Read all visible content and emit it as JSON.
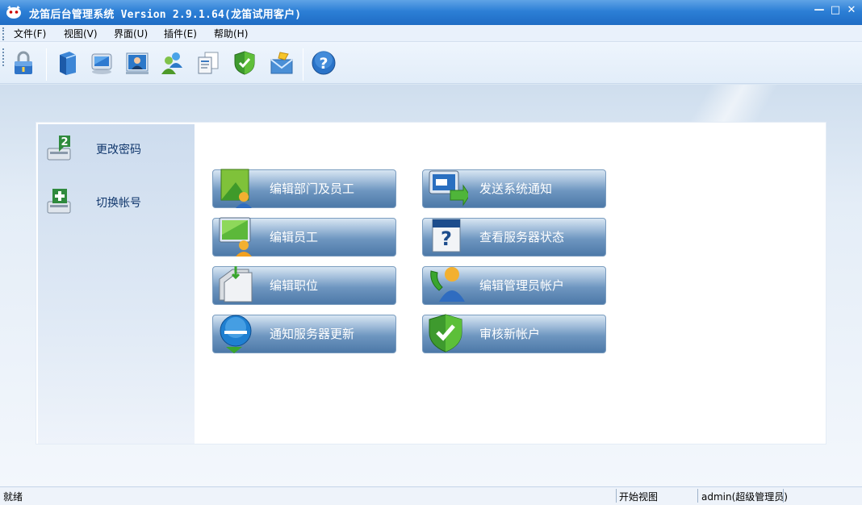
{
  "window": {
    "title": "龙笛后台管理系统 Version 2.9.1.64(龙笛试用客户)",
    "minimize_label": "—",
    "maximize_label": "□",
    "close_label": "✕"
  },
  "menu": {
    "items": [
      {
        "label": "文件(F)"
      },
      {
        "label": "视图(V)"
      },
      {
        "label": "界面(U)"
      },
      {
        "label": "插件(E)"
      },
      {
        "label": "帮助(H)"
      }
    ]
  },
  "toolbar": {
    "icons": [
      "lock-icon",
      "book-icon",
      "monitor-icon",
      "user-card-icon",
      "users-icon",
      "documents-icon",
      "shield-check-icon",
      "mail-icon",
      "help-icon"
    ]
  },
  "sidebar": {
    "items": [
      {
        "label": "更改密码",
        "icon": "change-password-icon"
      },
      {
        "label": "切换帐号",
        "icon": "switch-account-icon"
      }
    ]
  },
  "functions": {
    "buttons": [
      {
        "label": "编辑部门及员工",
        "icon": "department-icon"
      },
      {
        "label": "发送系统通知",
        "icon": "notify-icon"
      },
      {
        "label": "编辑员工",
        "icon": "employee-icon"
      },
      {
        "label": "查看服务器状态",
        "icon": "server-status-icon"
      },
      {
        "label": "编辑职位",
        "icon": "position-icon"
      },
      {
        "label": "编辑管理员帐户",
        "icon": "admin-icon"
      },
      {
        "label": "通知服务器更新",
        "icon": "update-icon"
      },
      {
        "label": "审核新帐户",
        "icon": "approve-icon"
      }
    ]
  },
  "status": {
    "ready": "就绪",
    "view": "开始视图",
    "user": "admin(超级管理员)"
  }
}
